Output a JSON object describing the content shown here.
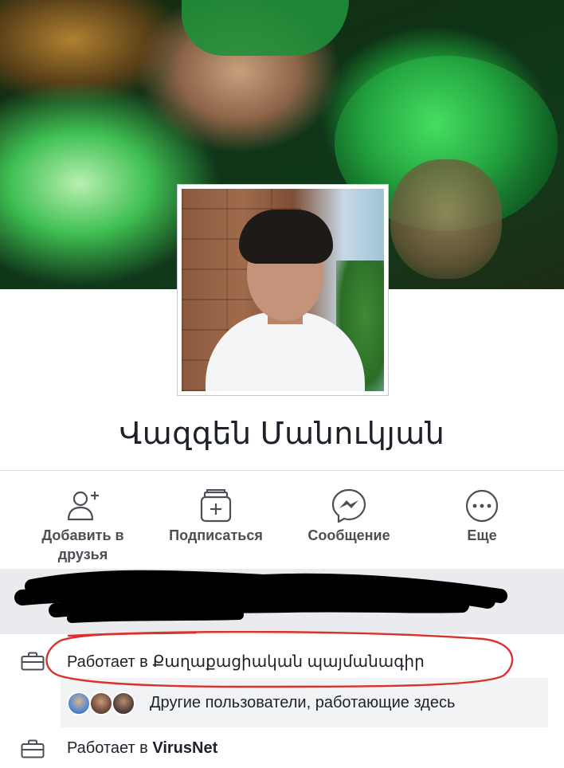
{
  "profile": {
    "name": "Վազգեն Մանուկյան"
  },
  "actions": [
    {
      "label": "Добавить в друзья",
      "icon": "add-friend-icon"
    },
    {
      "label": "Подписаться",
      "icon": "follow-icon"
    },
    {
      "label": "Сообщение",
      "icon": "messenger-icon"
    },
    {
      "label": "Еще",
      "icon": "more-icon"
    }
  ],
  "work": [
    {
      "prefix": "Работает в ",
      "org": "Քաղաքացիական պայմանագիր",
      "icon": "briefcase-icon"
    },
    {
      "prefix": "Работает в ",
      "org": "VirusNet",
      "icon": "briefcase-icon"
    }
  ],
  "coworkers": {
    "text": "Другие пользователи, работающие здесь"
  },
  "colors": {
    "icon_gray": "#4b4f56",
    "annotation_red": "#d9322c",
    "redaction": "#000000",
    "band": "#e9ebee"
  }
}
